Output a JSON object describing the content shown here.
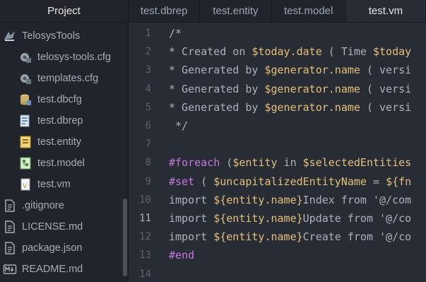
{
  "sidebar": {
    "title": "Project",
    "items": [
      {
        "label": "TelosysTools",
        "icon": "telosys-folder-icon"
      },
      {
        "label": "telosys-tools.cfg",
        "icon": "config-file-icon"
      },
      {
        "label": "templates.cfg",
        "icon": "config-file-icon"
      },
      {
        "label": "test.dbcfg",
        "icon": "database-file-icon"
      },
      {
        "label": "test.dbrep",
        "icon": "dbrep-file-icon"
      },
      {
        "label": "test.entity",
        "icon": "entity-file-icon"
      },
      {
        "label": "test.model",
        "icon": "model-file-icon"
      },
      {
        "label": "test.vm",
        "icon": "vm-file-icon"
      },
      {
        "label": ".gitignore",
        "icon": "text-file-icon"
      },
      {
        "label": "LICENSE.md",
        "icon": "text-file-icon"
      },
      {
        "label": "package.json",
        "icon": "text-file-icon"
      },
      {
        "label": "README.md",
        "icon": "markdown-file-icon"
      }
    ]
  },
  "tabs": [
    {
      "label": "test.dbrep",
      "active": false
    },
    {
      "label": "test.entity",
      "active": false
    },
    {
      "label": "test.model",
      "active": false
    },
    {
      "label": "test.vm",
      "active": true
    }
  ],
  "editor": {
    "current_line": 11,
    "line_numbers": [
      "1",
      "2",
      "3",
      "4",
      "5",
      "6",
      "7",
      "8",
      "9",
      "10",
      "11",
      "12",
      "13",
      "14"
    ],
    "lines": [
      [
        {
          "t": "/*",
          "c": "comment"
        }
      ],
      [
        {
          "t": "* Created on ",
          "c": "comment"
        },
        {
          "t": "$today.date",
          "c": "var"
        },
        {
          "t": " ( Time ",
          "c": "comment"
        },
        {
          "t": "$today",
          "c": "var"
        }
      ],
      [
        {
          "t": "* Generated by ",
          "c": "comment"
        },
        {
          "t": "$generator.name",
          "c": "var"
        },
        {
          "t": " ( versi",
          "c": "comment"
        }
      ],
      [
        {
          "t": "* Generated by ",
          "c": "comment"
        },
        {
          "t": "$generator.name",
          "c": "var"
        },
        {
          "t": " ( versi",
          "c": "comment"
        }
      ],
      [
        {
          "t": "* Generated by ",
          "c": "comment"
        },
        {
          "t": "$generator.name",
          "c": "var"
        },
        {
          "t": " ( versi",
          "c": "comment"
        }
      ],
      [
        {
          "t": " */",
          "c": "comment"
        }
      ],
      [],
      [
        {
          "t": "#foreach",
          "c": "kw"
        },
        {
          "t": " (",
          "c": "plain"
        },
        {
          "t": "$entity",
          "c": "var"
        },
        {
          "t": " in ",
          "c": "plain"
        },
        {
          "t": "$selectedEntities",
          "c": "var"
        }
      ],
      [
        {
          "t": "#set",
          "c": "kw"
        },
        {
          "t": " ( ",
          "c": "plain"
        },
        {
          "t": "$uncapitalizedEntityName",
          "c": "var"
        },
        {
          "t": " = ",
          "c": "plain"
        },
        {
          "t": "${fn",
          "c": "var"
        }
      ],
      [
        {
          "t": "import ",
          "c": "plain"
        },
        {
          "t": "${entity.name}",
          "c": "var"
        },
        {
          "t": "Index from '@/com",
          "c": "plain"
        }
      ],
      [
        {
          "t": "import ",
          "c": "plain"
        },
        {
          "t": "${entity.name}",
          "c": "var"
        },
        {
          "t": "Update from '@/co",
          "c": "plain"
        }
      ],
      [
        {
          "t": "import ",
          "c": "plain"
        },
        {
          "t": "${entity.name}",
          "c": "var"
        },
        {
          "t": "Create from '@/co",
          "c": "plain"
        }
      ],
      [
        {
          "t": "#end",
          "c": "kw"
        }
      ],
      []
    ]
  }
}
